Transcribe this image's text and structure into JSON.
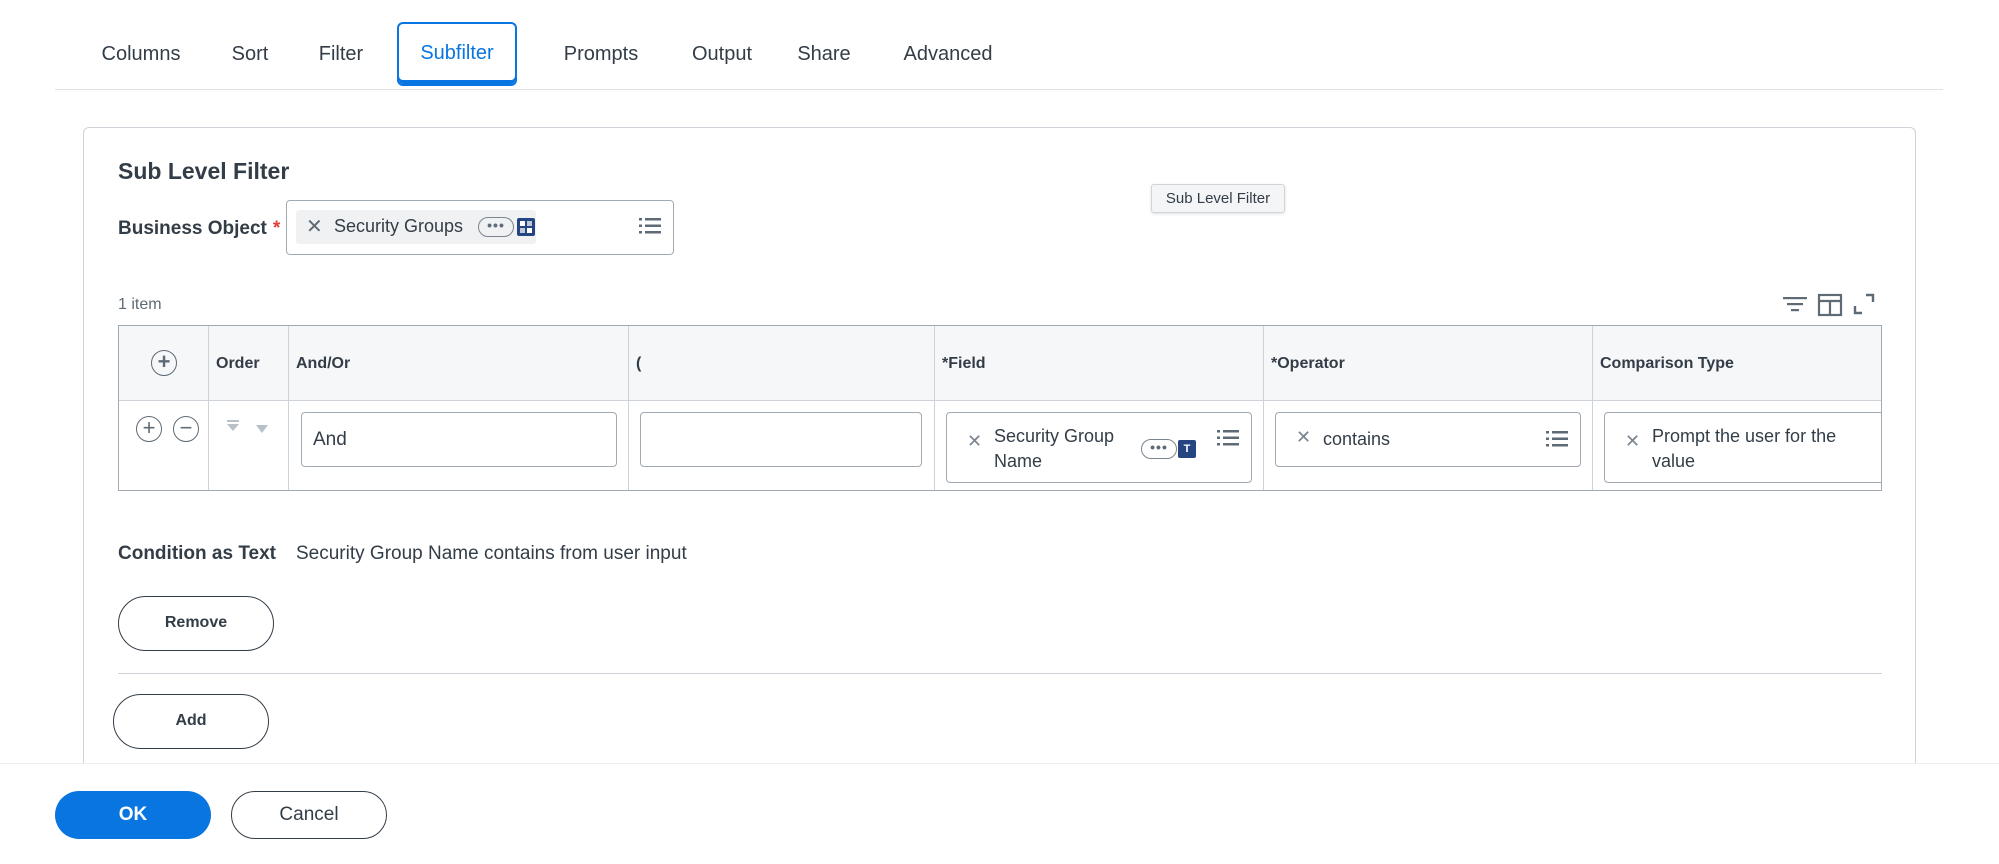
{
  "tabs": [
    {
      "label": "Columns"
    },
    {
      "label": "Sort"
    },
    {
      "label": "Filter"
    },
    {
      "label": "Subfilter",
      "active": true
    },
    {
      "label": "Prompts"
    },
    {
      "label": "Output"
    },
    {
      "label": "Share"
    },
    {
      "label": "Advanced"
    }
  ],
  "card": {
    "title": "Sub Level Filter",
    "tooltip": "Sub Level Filter",
    "business_object": {
      "label": "Business Object",
      "required_mark": "*",
      "value": "Security Groups",
      "dots": "•••"
    },
    "item_count": "1 item"
  },
  "table": {
    "headers": {
      "order": "Order",
      "and_or": "And/Or",
      "paren": "(",
      "field": "*Field",
      "operator": "*Operator",
      "comparison_type": "Comparison Type"
    },
    "row": {
      "and_or": "And",
      "paren": "",
      "field": "Security Group Name",
      "field_badge": "T",
      "field_dots": "•••",
      "operator": "contains",
      "comparison_type": "Prompt the user for the value"
    }
  },
  "condition": {
    "label": "Condition as Text",
    "text": "Security Group Name contains from user input"
  },
  "buttons": {
    "remove": "Remove",
    "add": "Add",
    "ok": "OK",
    "cancel": "Cancel"
  },
  "colors": {
    "accent": "#0875e1",
    "required": "#de4040",
    "badge": "#244581"
  }
}
